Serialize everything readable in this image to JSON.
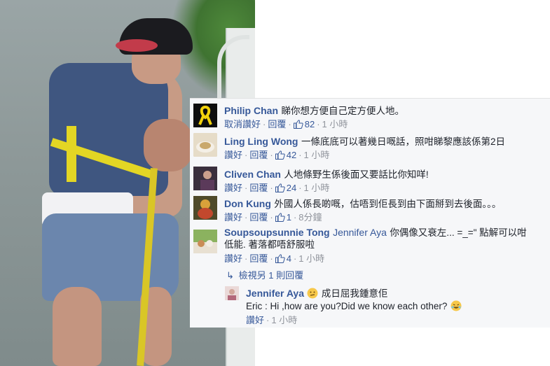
{
  "comments": [
    {
      "name": "Philip Chan",
      "text": "睇你想方便自己定方便人地。",
      "action1": "取消讚好",
      "action2": "回覆",
      "likes": "82",
      "time": "1 小時"
    },
    {
      "name": "Ling Ling Wong",
      "text": "一條底底可以著幾日嘅話，照咁睇黎應該係第2日",
      "action1": "讚好",
      "action2": "回覆",
      "likes": "42",
      "time": "1 小時"
    },
    {
      "name": "Cliven Chan",
      "text": "人地條野生係後面又要話比你知咩!",
      "action1": "讚好",
      "action2": "回覆",
      "likes": "24",
      "time": "1 小時"
    },
    {
      "name": "Don Kung",
      "text": "外國人係長啲嘅，估唔到佢長到由下面掰到去後面。。。",
      "action1": "讚好",
      "action2": "回覆",
      "likes": "1",
      "time": "8分鐘"
    },
    {
      "name": "Soupsoupsunnie Tong",
      "mention": "Jennifer Aya",
      "text_line1": "你偶像又衰左... =_=\" 點解可以咁",
      "text_line2": "低能. 著落都唔舒服啦",
      "action1": "讚好",
      "action2": "回覆",
      "likes": "4",
      "time": "1 小時"
    }
  ],
  "view_replies": "檢視另 1 則回覆",
  "reply": {
    "name": "Jennifer Aya",
    "text_line1": "成日屈我鍾意佢",
    "text_line2": "Eric : Hi ,how are you?Did we know each other?",
    "action1": "讚好",
    "time": "1 小時"
  },
  "colors": {
    "link": "#365899",
    "meta": "#90949c",
    "panel_bg": "#f6f7f9"
  }
}
